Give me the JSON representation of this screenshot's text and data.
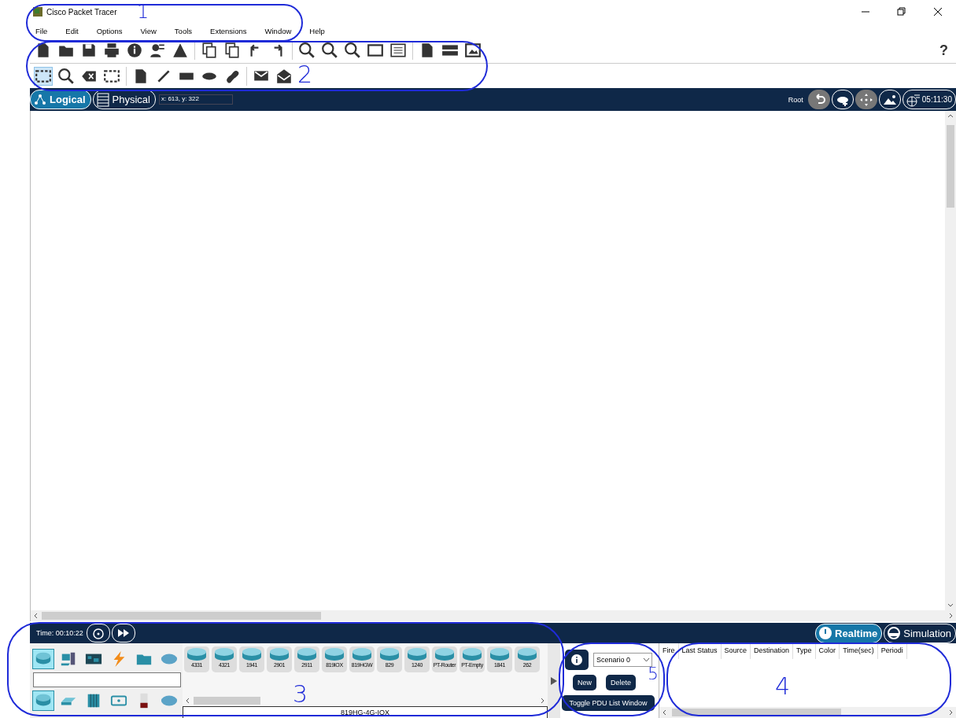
{
  "window": {
    "title": "Cisco Packet Tracer"
  },
  "menu": [
    "File",
    "Edit",
    "Options",
    "View",
    "Tools",
    "Extensions",
    "Window",
    "Help"
  ],
  "help_button": "?",
  "workspace_tabs": [
    {
      "label": "Logical",
      "selected": true
    },
    {
      "label": "Physical",
      "selected": false
    }
  ],
  "cursor_position": "x: 613, y: 322",
  "root_label": "Root",
  "clock": "05:11:30",
  "time_bar": {
    "time": "Time: 00:10:22"
  },
  "modes": [
    {
      "label": "Realtime",
      "selected": true
    },
    {
      "label": "Simulation",
      "selected": false
    }
  ],
  "device_categories": [
    {
      "kind": "network",
      "selected": true
    },
    {
      "kind": "end-device",
      "selected": false
    },
    {
      "kind": "component",
      "selected": false
    },
    {
      "kind": "connection",
      "selected": false
    },
    {
      "kind": "misc",
      "selected": false
    },
    {
      "kind": "multiuser",
      "selected": false
    }
  ],
  "device_subcategories": [
    {
      "kind": "router",
      "selected": true
    },
    {
      "kind": "switch",
      "selected": false
    },
    {
      "kind": "hub",
      "selected": false
    },
    {
      "kind": "wireless",
      "selected": false
    },
    {
      "kind": "security",
      "selected": false
    },
    {
      "kind": "wan",
      "selected": false
    }
  ],
  "devices": [
    "4331",
    "4321",
    "1941",
    "2901",
    "2911",
    "819IOX",
    "819HGW",
    "829",
    "1240",
    "PT-Router",
    "PT-Empty",
    "1841",
    "262"
  ],
  "device_model": "819HG-4G-IOX",
  "scenario": {
    "value": "Scenario 0"
  },
  "scenario_buttons": [
    "New",
    "Delete"
  ],
  "toggle_button": "Toggle PDU List Window",
  "pdu_columns": [
    "Fire",
    "Last Status",
    "Source",
    "Destination",
    "Type",
    "Color",
    "Time(sec)",
    "Periodi"
  ],
  "annotations": [
    "1",
    "2",
    "3",
    "5",
    "4"
  ]
}
